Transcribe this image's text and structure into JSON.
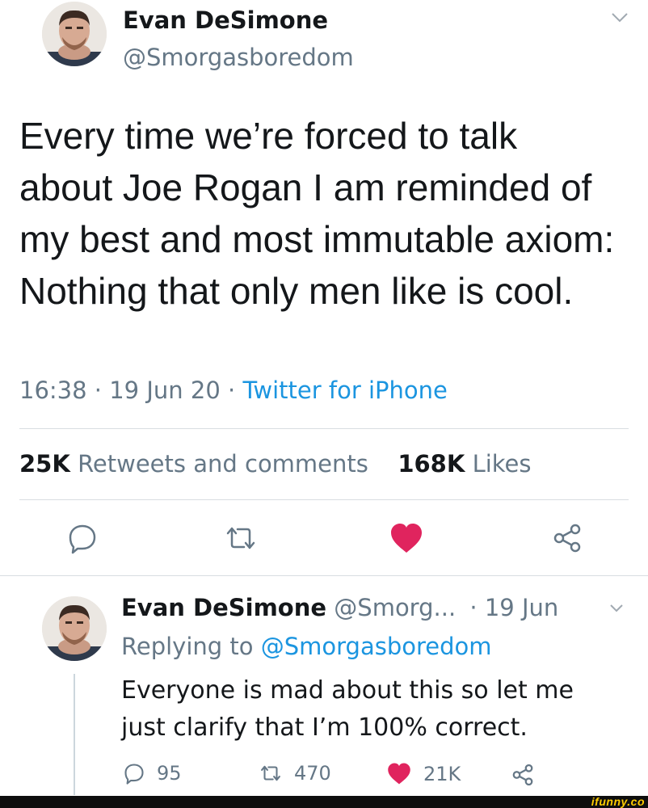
{
  "tweet": {
    "author_name": "Evan DeSimone",
    "author_handle": "@Smorgasboredom",
    "text": "Every time we’re forced to talk about Joe Rogan I am reminded of my best and most immutable axiom: Nothing that only men like is cool.",
    "time": "16:38",
    "date": "19 Jun 20",
    "separator": "·",
    "source": "Twitter for iPhone",
    "retweets_count": "25K",
    "retweets_label": "Retweets and comments",
    "likes_count": "168K",
    "likes_label": "Likes"
  },
  "reply": {
    "author_name": "Evan DeSimone",
    "author_handle": "@Smorg...",
    "date": "· 19 Jun",
    "replying_prefix": "Replying to",
    "replying_handle": "@Smorgasboredom",
    "text": "Everyone is mad about this so let me just clarify that I’m 100% correct.",
    "reply_count": "95",
    "retweet_count": "470",
    "like_count": "21K"
  },
  "watermark": "ifunny.co",
  "colors": {
    "like_red": "#e0245e",
    "link_blue": "#1b95e0",
    "muted_gray": "#657786",
    "icon_gray": "#657786"
  },
  "icons": [
    "chevron-down-icon",
    "reply-icon",
    "retweet-icon",
    "heart-icon",
    "share-icon"
  ]
}
